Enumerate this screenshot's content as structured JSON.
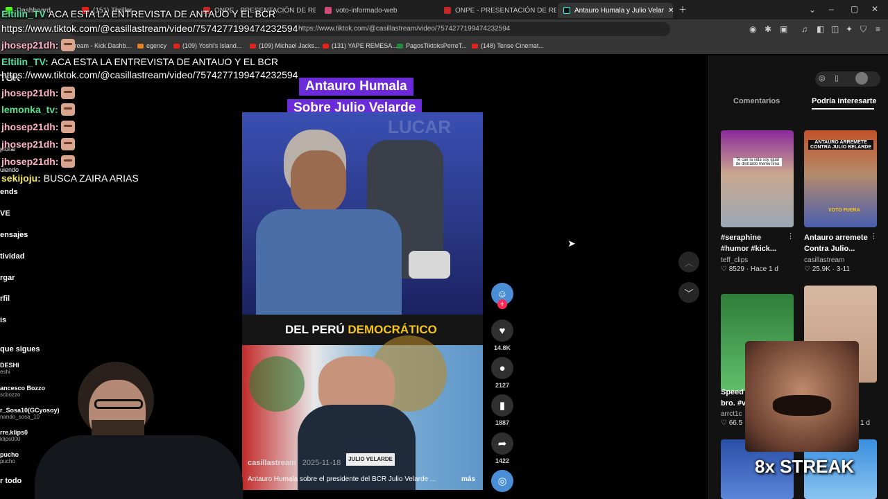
{
  "tabs": [
    {
      "label": "Dashboard",
      "active": false
    },
    {
      "label": "(151) Thriller ...",
      "active": false
    },
    {
      "label": "ONPE - PRESENTACIÓN DE RESULTA",
      "active": false
    },
    {
      "label": "voto-informado-web",
      "active": false
    },
    {
      "label": "ONPE - PRESENTACIÓN DE RESULTA",
      "active": false
    },
    {
      "label": "Antauro Humala y Julio Velar",
      "active": true
    }
  ],
  "address": "https://www.tiktok.com/@casillastream/video/7574277199474232594",
  "bookmarks": [
    "tream - Kick Dashb...",
    "egency",
    "(109) Yoshi's Island...",
    "(109) Michael Jacks...",
    "(131) YAPE REMESA...",
    "PagosTiktoksPerreT...",
    "(148) Tense Cinemat..."
  ],
  "overlay": {
    "top_user": "Eltilin_TV",
    "top_msg": "ACA ESTA LA ENTREVISTA DE ANTAUO Y EL BCR",
    "top_url": "https://www.tiktok.com/@casillastream/video/7574277199474232594"
  },
  "chat": [
    {
      "user": "jhosep21dh:",
      "msg": "",
      "color": "#ffb3c8",
      "emote": true
    },
    {
      "user": "Eltilin_TV:",
      "msg": "ACA ESTA LA ENTREVISTA DE ANTAUO Y EL BCR",
      "color": "#57e0a0",
      "emote": false
    },
    {
      "user": "",
      "msg": "https://www.tiktok.com/@casillastream/video/7574277199474232594",
      "color": "#ffffff",
      "emote": false
    },
    {
      "user": "jhosep21dh:",
      "msg": "",
      "color": "#ffb3c8",
      "emote": true
    },
    {
      "user": "lemonka_tv:",
      "msg": "",
      "color": "#57e08a",
      "emote": true
    },
    {
      "user": "jhosep21dh:",
      "msg": "",
      "color": "#ffb3c8",
      "emote": true
    },
    {
      "user": "jhosep21dh:",
      "msg": "",
      "color": "#ffb3c8",
      "emote": true
    },
    {
      "user": "jhosep21dh:",
      "msg": "",
      "color": "#ffb3c8",
      "emote": true
    },
    {
      "user": "sekijoju:",
      "msg": "BUSCA ZAIRA ARIAS",
      "color": "#f5e66a",
      "emote": false
    }
  ],
  "sidebar_fragments": {
    "brand": "TOK",
    "explorar": "plorar",
    "siguiendo": "uiendo",
    "items": [
      "ends",
      "VE",
      "ensajes",
      "tividad",
      "rgar",
      "rfil",
      "is"
    ],
    "section": "que sigues"
  },
  "following": [
    {
      "name": "DESHI",
      "handle": "eshi"
    },
    {
      "name": "ancesco Bozzo",
      "handle": "scbozzo"
    },
    {
      "name": "r_Sosa10(GCyosoy)",
      "handle": "nando_sosa_10"
    },
    {
      "name": "rre.klips0",
      "handle": "klips000"
    },
    {
      "name": "pucho",
      "handle": "pucho"
    }
  ],
  "sidebar_bottom": "r todo",
  "video": {
    "title_line1": "Antauro Humala",
    "title_line2": "Sobre Julio Velarde",
    "watermark": "LUCAR",
    "banner_pre": "DEL PERÚ ",
    "banner_hl": "DEMOCRÁTICO",
    "nameplate": "JULIO VELARDE",
    "author": "casillastream",
    "date": "2025-11-18",
    "caption": "Antauro Humala sobre el presidente del BCR Julio Velarde ...",
    "more": "más"
  },
  "actions": {
    "likes": "14.8K",
    "comments": "2127",
    "saves": "1887",
    "shares": "1422"
  },
  "panel": {
    "tab_comments": "Comentarios",
    "tab_interest": "Podría interesarte",
    "items": [
      {
        "caption1": "#seraphine",
        "caption2": "#humor #kick...",
        "author": "teff_clips",
        "likes": "8529",
        "date": "Hace 1 d"
      },
      {
        "caption1": "Antauro arremete",
        "caption2": "Contra Julio...",
        "author": "casillastream",
        "likes": "25.9K",
        "date": "3-11"
      },
      {
        "caption1": "Speed",
        "caption2": "bro. #v",
        "author": "arrct1c",
        "likes": "66.5",
        "date": "1 d"
      }
    ],
    "thumb_text_1": "Te cae la vida soy igual de distraído meme lima",
    "thumb_text_2": "ANTAURO ARREMETE CONTRA JULIO BELARDE",
    "thumb_text_2b": "VOTO FUERA",
    "streak": "8x STREAK"
  },
  "colors": {
    "tiktok_red": "#fe2c55",
    "purple": "#6c2bd9",
    "gold": "#f5c518"
  }
}
